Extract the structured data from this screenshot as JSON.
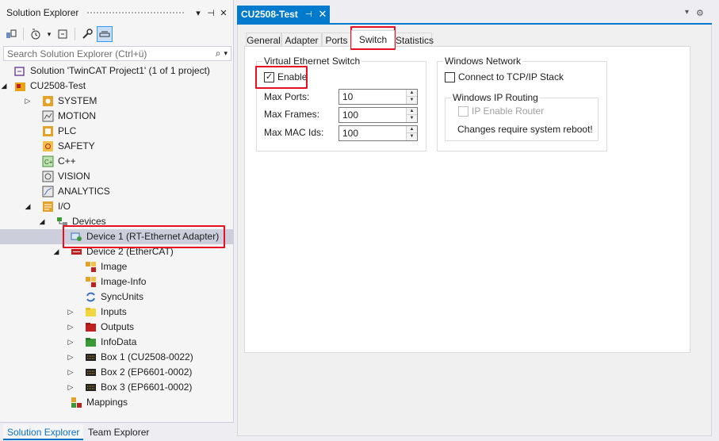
{
  "solution_explorer": {
    "title": "Solution Explorer",
    "search_placeholder": "Search Solution Explorer (Ctrl+ü)",
    "tree": [
      {
        "label": "Solution 'TwinCAT Project1' (1 of 1 project)",
        "level": 0,
        "arrow": "",
        "icon": "solution-icon"
      },
      {
        "label": "CU2508-Test",
        "level": 0,
        "arrow": "expanded",
        "icon": "twincat-project-icon"
      },
      {
        "label": "SYSTEM",
        "level": 1,
        "arrow": "collapsed",
        "icon": "system-icon"
      },
      {
        "label": "MOTION",
        "level": 1,
        "arrow": "",
        "icon": "motion-icon"
      },
      {
        "label": "PLC",
        "level": 1,
        "arrow": "",
        "icon": "plc-icon"
      },
      {
        "label": "SAFETY",
        "level": 1,
        "arrow": "",
        "icon": "safety-icon"
      },
      {
        "label": "C++",
        "level": 1,
        "arrow": "",
        "icon": "cpp-icon"
      },
      {
        "label": "VISION",
        "level": 1,
        "arrow": "",
        "icon": "vision-icon"
      },
      {
        "label": "ANALYTICS",
        "level": 1,
        "arrow": "",
        "icon": "analytics-icon"
      },
      {
        "label": "I/O",
        "level": 1,
        "arrow": "expanded",
        "icon": "io-icon"
      },
      {
        "label": "Devices",
        "level": 2,
        "arrow": "expanded",
        "icon": "devices-icon"
      },
      {
        "label": "Device 1 (RT-Ethernet Adapter)",
        "level": 3,
        "arrow": "",
        "icon": "ethernet-adapter-icon",
        "selected": true
      },
      {
        "label": "Device 2 (EtherCAT)",
        "level": 3,
        "arrow": "expanded",
        "icon": "ethercat-device-icon"
      },
      {
        "label": "Image",
        "level": 4,
        "arrow": "",
        "icon": "image-icon"
      },
      {
        "label": "Image-Info",
        "level": 4,
        "arrow": "",
        "icon": "image-info-icon"
      },
      {
        "label": "SyncUnits",
        "level": 4,
        "arrow": "",
        "icon": "sync-units-icon"
      },
      {
        "label": "Inputs",
        "level": 4,
        "arrow": "collapsed",
        "icon": "inputs-icon"
      },
      {
        "label": "Outputs",
        "level": 4,
        "arrow": "collapsed",
        "icon": "outputs-icon"
      },
      {
        "label": "InfoData",
        "level": 4,
        "arrow": "collapsed",
        "icon": "infodata-icon"
      },
      {
        "label": "Box 1 (CU2508-0022)",
        "level": 4,
        "arrow": "collapsed",
        "icon": "box-icon"
      },
      {
        "label": "Box 2 (EP6601-0002)",
        "level": 4,
        "arrow": "collapsed",
        "icon": "box-icon"
      },
      {
        "label": "Box 3 (EP6601-0002)",
        "level": 4,
        "arrow": "collapsed",
        "icon": "box-icon"
      },
      {
        "label": "Mappings",
        "level": 3,
        "arrow": "",
        "icon": "mappings-icon"
      }
    ],
    "bottom_tabs": [
      "Solution Explorer",
      "Team Explorer"
    ]
  },
  "document": {
    "tab_title": "CU2508-Test",
    "property_tabs": [
      "General",
      "Adapter",
      "Ports",
      "Switch",
      "Statistics"
    ],
    "active_tab": "Switch",
    "virtual_switch": {
      "title": "Virtual Ethernet Switch",
      "enable_label": "Enable",
      "enable_checked": true,
      "fields": [
        {
          "label": "Max Ports:",
          "value": "10"
        },
        {
          "label": "Max Frames:",
          "value": "100"
        },
        {
          "label": "Max MAC Ids:",
          "value": "100"
        }
      ]
    },
    "windows_network": {
      "title": "Windows Network",
      "connect_label": "Connect to TCP/IP Stack",
      "connect_checked": false,
      "routing_title": "Windows IP Routing",
      "ip_enable_label": "IP Enable Router",
      "ip_enable_checked": false,
      "note": "Changes require system reboot!"
    }
  },
  "colors": {
    "accent": "#007acc",
    "highlight": "#e81123",
    "selection": "#cccedb"
  }
}
